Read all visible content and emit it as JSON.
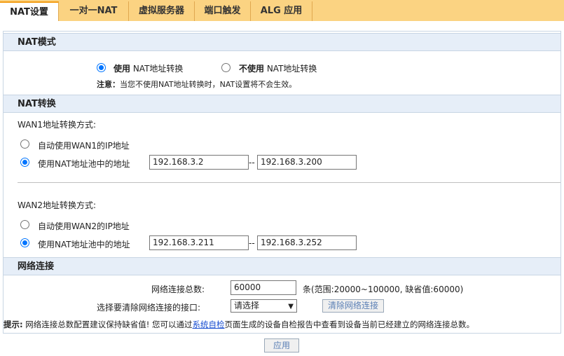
{
  "tabs": [
    {
      "label": "NAT设置"
    },
    {
      "label": "一对一NAT"
    },
    {
      "label": "虚拟服务器"
    },
    {
      "label": "端口触发"
    },
    {
      "label": "ALG 应用"
    }
  ],
  "nat_mode": {
    "title": "NAT模式",
    "use_bold": "使用",
    "use_rest": " NAT地址转换",
    "nouse_bold": "不使用",
    "nouse_rest": " NAT地址转换",
    "note_bold": "注意：",
    "note_text": "当您不使用NAT地址转换时，NAT设置将不会生效。"
  },
  "nat_conv": {
    "title": "NAT转换",
    "wan1": {
      "label": "WAN1地址转换方式:",
      "auto": "自动使用WAN1的IP地址",
      "pool": "使用NAT地址池中的地址",
      "start": "192.168.3.2",
      "dash": "--",
      "end": "192.168.3.200"
    },
    "wan2": {
      "label": "WAN2地址转换方式:",
      "auto": "自动使用WAN2的IP地址",
      "pool": "使用NAT地址池中的地址",
      "start": "192.168.3.211",
      "dash": "--",
      "end": "192.168.3.252"
    }
  },
  "net_conn": {
    "title": "网络连接",
    "total_label": "网络连接总数:",
    "total_value": "60000",
    "range_text": "条(范围:20000~100000, 缺省值:60000)",
    "iface_label": "选择要清除网络连接的接口:",
    "iface_selected": "请选择",
    "clear_button": "清除网络连接"
  },
  "tip": {
    "bold": "提示:",
    "text1": " 网络连接总数配置建议保持缺省值! 您可以通过",
    "link": "系统自检",
    "text2": "页面生成的设备自检报告中查看到设备当前已经建立的网络连接总数。"
  },
  "apply_button": "应用",
  "colors": {
    "tab_bg": "#fbd382",
    "section_bg": "#e6eef8",
    "radio_accent": "#0075ff"
  }
}
